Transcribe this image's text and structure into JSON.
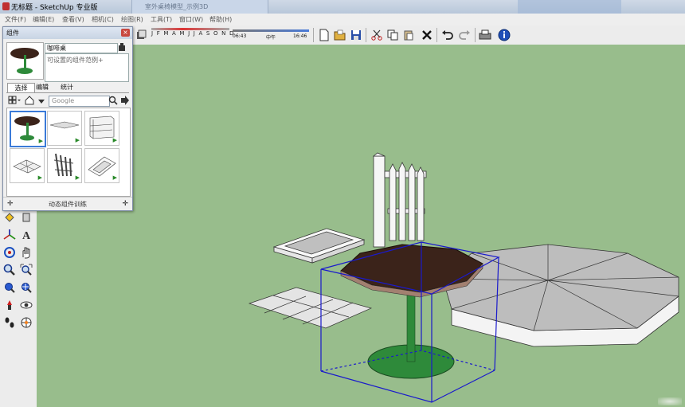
{
  "window": {
    "title": "无标题 - SketchUp 专业版",
    "second_tab": "室外桌椅模型_示例3D"
  },
  "menu": [
    "文件(F)",
    "编辑(E)",
    "查看(V)",
    "相机(C)",
    "绘图(R)",
    "工具(T)",
    "窗口(W)",
    "帮助(H)"
  ],
  "toolbar": {
    "months": "J F M A M J J A S O N D",
    "time_start": "06:43",
    "time_mid": "中午",
    "time_end": "16:46",
    "icons": [
      "new-icon",
      "open-icon",
      "save-icon",
      "cut-icon",
      "copy-icon",
      "paste-icon",
      "erase-icon",
      "undo-icon",
      "redo-icon",
      "print-icon",
      "model-info-icon"
    ]
  },
  "components_panel": {
    "title": "组件",
    "component_name": "咖啡桌",
    "description": "可设置的组件范例+",
    "tabs": [
      "选择",
      "编辑",
      "统计"
    ],
    "search_placeholder": "Google",
    "footer": "动态组件训练",
    "thumbnails": [
      "coffee-table",
      "slab",
      "shelf",
      "pavers",
      "fence",
      "frame"
    ]
  },
  "left_tools": [
    "paint-icon",
    "tape-icon",
    "axes-icon",
    "text-icon",
    "orbit-icon",
    "pan-icon",
    "zoom-icon",
    "zoom-window-icon",
    "prev-view-icon",
    "zoom-extents-icon",
    "position-camera-icon",
    "look-around-icon",
    "walk-icon",
    "section-icon"
  ],
  "colors": {
    "ground": "#98bd8c",
    "tabletop": "#3b231a",
    "stem": "#2e8a3a",
    "selection": "#1a1acc",
    "octagon": "#bdbdbd"
  }
}
